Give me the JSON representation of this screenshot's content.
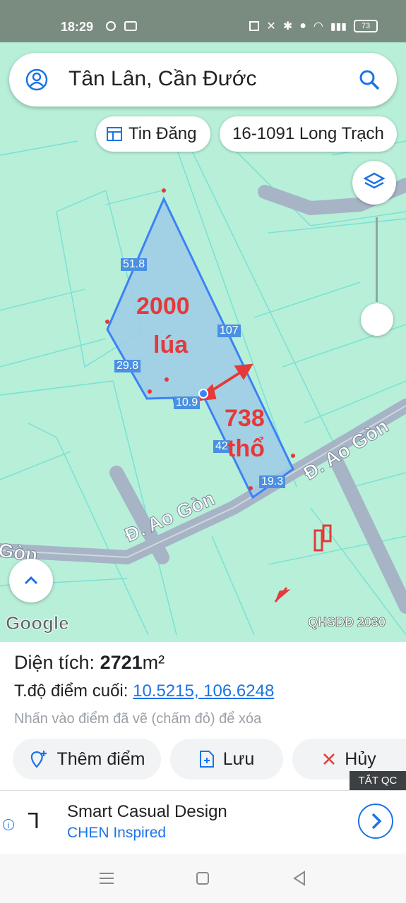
{
  "status": {
    "time": "18:29",
    "battery": "73"
  },
  "search": {
    "query": "Tân Lân, Cần Đước"
  },
  "chips": {
    "news": "Tin Đăng",
    "location": "16-1091 Long Trạch"
  },
  "map": {
    "edge_labels": [
      "51.8",
      "107",
      "29.8",
      "10.9",
      "42",
      "19.3"
    ],
    "annotation_top_line1": "2000",
    "annotation_top_line2": "lúa",
    "annotation_bottom_line1": "738",
    "annotation_bottom_line2": "thổ",
    "road_upper": "Đ. Ao Gòn",
    "road_lower": "Đ. Ao Gòn",
    "road_left": "Gòn",
    "google_logo": "Google",
    "layer_badge": "QHSDĐ 2030"
  },
  "panel": {
    "area_label": "Diện tích:",
    "area_value": "2721",
    "area_unit": "m²",
    "coord_label": "T.độ điểm cuối:",
    "coord_value": "10.5215, 106.6248",
    "hint": "Nhấn vào điểm đã vẽ (chấm đỏ) để xóa",
    "btn_add": "Thêm điểm",
    "btn_save": "Lưu",
    "btn_cancel": "Hủy",
    "close_ads": "TẮT QC"
  },
  "ad": {
    "title": "Smart Casual Design",
    "subtitle": "CHEN Inspired"
  },
  "colors": {
    "map_bg": "#b7efd8",
    "parcel_fill": "#9fcbe8",
    "parcel_stroke": "#3b82f6",
    "accent_red": "#e5393a",
    "link_blue": "#1a73e8"
  }
}
